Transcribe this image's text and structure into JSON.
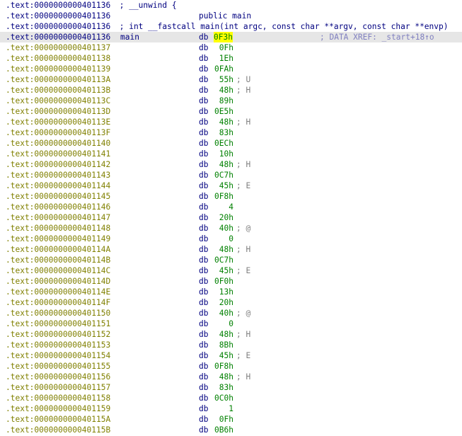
{
  "header": [
    {
      "address": ".text:0000000000401136",
      "text": " ; __unwind {"
    },
    {
      "address": ".text:0000000000401136",
      "public": "public main"
    },
    {
      "address": ".text:0000000000401136",
      "text": " ; int __fastcall main(int argc, const char **argv, const char **envp)"
    }
  ],
  "main_line": {
    "address": ".text:0000000000401136",
    "label": "main",
    "mnemonic": "db",
    "operand": "0F3h",
    "xref": "; DATA XREF: _start+18↑o"
  },
  "rows": [
    {
      "address": ".text:0000000000401137",
      "mnemonic": "db",
      "operand": "0Fh",
      "comment": ""
    },
    {
      "address": ".text:0000000000401138",
      "mnemonic": "db",
      "operand": "1Eh",
      "comment": ""
    },
    {
      "address": ".text:0000000000401139",
      "mnemonic": "db",
      "operand": "0FAh",
      "comment": ""
    },
    {
      "address": ".text:000000000040113A",
      "mnemonic": "db",
      "operand": "55h",
      "comment": "; U"
    },
    {
      "address": ".text:000000000040113B",
      "mnemonic": "db",
      "operand": "48h",
      "comment": "; H"
    },
    {
      "address": ".text:000000000040113C",
      "mnemonic": "db",
      "operand": "89h",
      "comment": ""
    },
    {
      "address": ".text:000000000040113D",
      "mnemonic": "db",
      "operand": "0E5h",
      "comment": ""
    },
    {
      "address": ".text:000000000040113E",
      "mnemonic": "db",
      "operand": "48h",
      "comment": "; H"
    },
    {
      "address": ".text:000000000040113F",
      "mnemonic": "db",
      "operand": "83h",
      "comment": ""
    },
    {
      "address": ".text:0000000000401140",
      "mnemonic": "db",
      "operand": "0ECh",
      "comment": ""
    },
    {
      "address": ".text:0000000000401141",
      "mnemonic": "db",
      "operand": "10h",
      "comment": ""
    },
    {
      "address": ".text:0000000000401142",
      "mnemonic": "db",
      "operand": "48h",
      "comment": "; H"
    },
    {
      "address": ".text:0000000000401143",
      "mnemonic": "db",
      "operand": "0C7h",
      "comment": ""
    },
    {
      "address": ".text:0000000000401144",
      "mnemonic": "db",
      "operand": "45h",
      "comment": "; E"
    },
    {
      "address": ".text:0000000000401145",
      "mnemonic": "db",
      "operand": "0F8h",
      "comment": ""
    },
    {
      "address": ".text:0000000000401146",
      "mnemonic": "db",
      "operand": "4",
      "comment": ""
    },
    {
      "address": ".text:0000000000401147",
      "mnemonic": "db",
      "operand": "20h",
      "comment": ""
    },
    {
      "address": ".text:0000000000401148",
      "mnemonic": "db",
      "operand": "40h",
      "comment": "; @"
    },
    {
      "address": ".text:0000000000401149",
      "mnemonic": "db",
      "operand": "0",
      "comment": ""
    },
    {
      "address": ".text:000000000040114A",
      "mnemonic": "db",
      "operand": "48h",
      "comment": "; H"
    },
    {
      "address": ".text:000000000040114B",
      "mnemonic": "db",
      "operand": "0C7h",
      "comment": ""
    },
    {
      "address": ".text:000000000040114C",
      "mnemonic": "db",
      "operand": "45h",
      "comment": "; E"
    },
    {
      "address": ".text:000000000040114D",
      "mnemonic": "db",
      "operand": "0F0h",
      "comment": ""
    },
    {
      "address": ".text:000000000040114E",
      "mnemonic": "db",
      "operand": "13h",
      "comment": ""
    },
    {
      "address": ".text:000000000040114F",
      "mnemonic": "db",
      "operand": "20h",
      "comment": ""
    },
    {
      "address": ".text:0000000000401150",
      "mnemonic": "db",
      "operand": "40h",
      "comment": "; @"
    },
    {
      "address": ".text:0000000000401151",
      "mnemonic": "db",
      "operand": "0",
      "comment": ""
    },
    {
      "address": ".text:0000000000401152",
      "mnemonic": "db",
      "operand": "48h",
      "comment": "; H"
    },
    {
      "address": ".text:0000000000401153",
      "mnemonic": "db",
      "operand": "8Bh",
      "comment": ""
    },
    {
      "address": ".text:0000000000401154",
      "mnemonic": "db",
      "operand": "45h",
      "comment": "; E"
    },
    {
      "address": ".text:0000000000401155",
      "mnemonic": "db",
      "operand": "0F8h",
      "comment": ""
    },
    {
      "address": ".text:0000000000401156",
      "mnemonic": "db",
      "operand": "48h",
      "comment": "; H"
    },
    {
      "address": ".text:0000000000401157",
      "mnemonic": "db",
      "operand": "83h",
      "comment": ""
    },
    {
      "address": ".text:0000000000401158",
      "mnemonic": "db",
      "operand": "0C0h",
      "comment": ""
    },
    {
      "address": ".text:0000000000401159",
      "mnemonic": "db",
      "operand": "1",
      "comment": ""
    },
    {
      "address": ".text:000000000040115A",
      "mnemonic": "db",
      "operand": "0Fh",
      "comment": ""
    },
    {
      "address": ".text:000000000040115B",
      "mnemonic": "db",
      "operand": "0B6h",
      "comment": ""
    }
  ],
  "colors": {
    "code_address": "#000080",
    "data_address": "#808000",
    "operand": "#008000",
    "comment": "#808080",
    "xref": "#8080c0",
    "cursor": "#ffff00",
    "highlight_line": "#e6e6e6"
  }
}
